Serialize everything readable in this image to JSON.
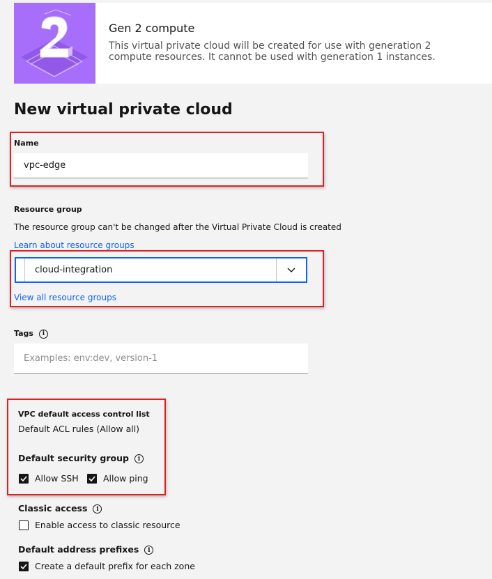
{
  "banner": {
    "title": "Gen 2 compute",
    "description": "This virtual private cloud will be created for use with generation 2 compute resources. It cannot be used with generation 1 instances."
  },
  "page_title": "New virtual private cloud",
  "name_field": {
    "label": "Name",
    "value": "vpc-edge"
  },
  "resource_group": {
    "label": "Resource group",
    "helper": "The resource group can't be changed after the Virtual Private Cloud is created",
    "learn_link": "Learn about resource groups",
    "selected": "cloud-integration",
    "view_all_link": "View all resource groups"
  },
  "tags": {
    "label": "Tags",
    "placeholder": "Examples: env:dev, version-1"
  },
  "acl": {
    "label": "VPC default access control list",
    "value": "Default ACL rules (Allow all)"
  },
  "security_group": {
    "label": "Default security group",
    "allow_ssh": "Allow SSH",
    "allow_ping": "Allow ping"
  },
  "classic_access": {
    "label": "Classic access",
    "option": "Enable access to classic resource"
  },
  "address_prefixes": {
    "label": "Default address prefixes",
    "option": "Create a default prefix for each zone"
  },
  "colors": {
    "banner_art": "#a66efa",
    "accent": "#0f62fe",
    "highlight": "#e02020"
  }
}
